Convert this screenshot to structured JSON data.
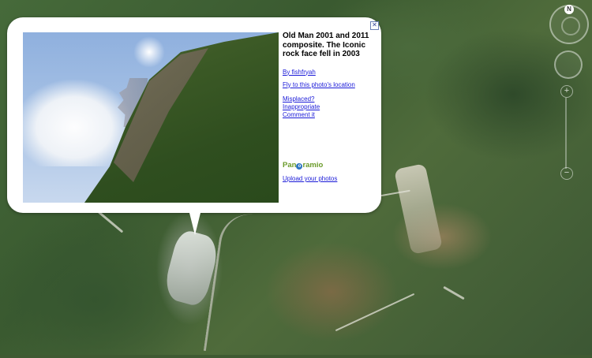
{
  "popup": {
    "title": "Old Man 2001 and 2011 composite. The Iconic rock face fell in 2003",
    "author_link": "By fishfryah",
    "fly_link": "Fly to this photo's location",
    "misplaced_link": "Misplaced?",
    "inappropriate_link": "Inappropriate",
    "comment_link": "Comment it",
    "logo_pre": "Pan",
    "logo_o": "o",
    "logo_post": "ramio",
    "upload_link": "Upload your photos",
    "close_symbol": "✕"
  },
  "nav": {
    "compass_label": "N",
    "zoom_in": "+",
    "zoom_out": "−"
  },
  "colors": {
    "link": "#1a1ad8",
    "logo_green": "#6b9b2a",
    "logo_blue": "#2e76c2"
  },
  "icons": [
    "close-icon",
    "compass-icon",
    "pan-control-icon",
    "zoom-slider-icon",
    "panoramio-logo"
  ]
}
